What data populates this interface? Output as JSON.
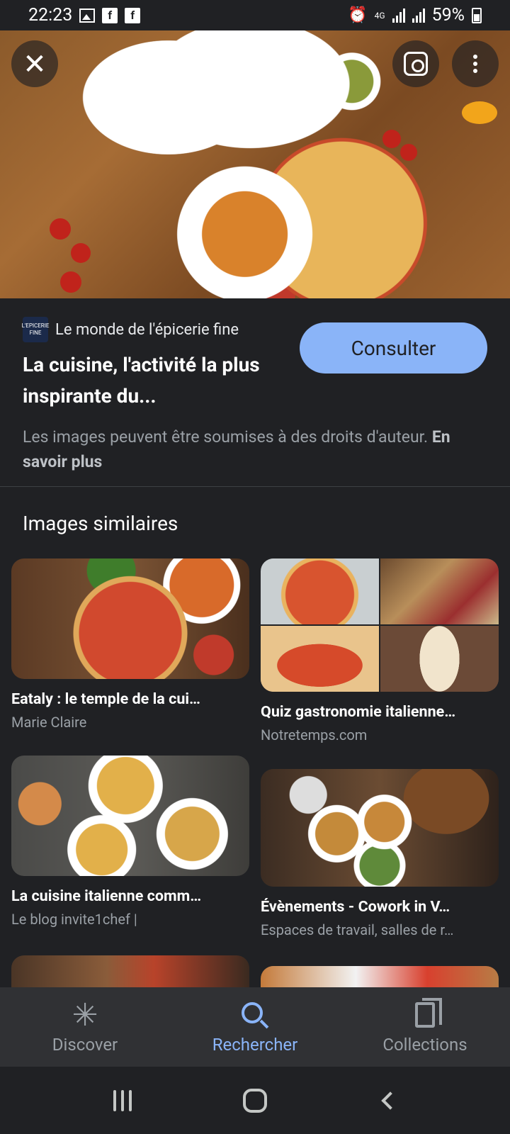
{
  "status_bar": {
    "time": "22:23",
    "network": "4G",
    "battery": "59%"
  },
  "hero": {
    "close_icon": "close-icon",
    "lens_icon": "lens-icon",
    "more_icon": "more-vert-icon"
  },
  "result": {
    "source_logo_text": "L'EPICERIE FINE",
    "source_name": "Le monde de l'épicerie fine",
    "title": "La cuisine, l'activité la plus inspirante du...",
    "visit_label": "Consulter",
    "rights_text": "Les images peuvent être soumises à des droits d'auteur.",
    "learn_more": "En savoir plus"
  },
  "similar": {
    "heading": "Images similaires",
    "items": [
      {
        "title": "Eataly : le temple de la cui…",
        "source": "Marie Claire"
      },
      {
        "title": "Quiz gastronomie italienne…",
        "source": "Notretemps.com"
      },
      {
        "title": "La cuisine italienne comm…",
        "source": "Le blog invite1chef |"
      },
      {
        "title": "Évènements - Cowork in V…",
        "source": "Espaces de travail, salles de r…"
      }
    ]
  },
  "bottom_nav": {
    "items": [
      {
        "label": "Discover",
        "icon": "asterisk-icon"
      },
      {
        "label": "Rechercher",
        "icon": "search-icon",
        "active": true
      },
      {
        "label": "Collections",
        "icon": "collections-icon"
      }
    ]
  },
  "colors": {
    "background": "#202124",
    "accent": "#8ab4f8",
    "text_secondary": "#9aa0a6"
  }
}
